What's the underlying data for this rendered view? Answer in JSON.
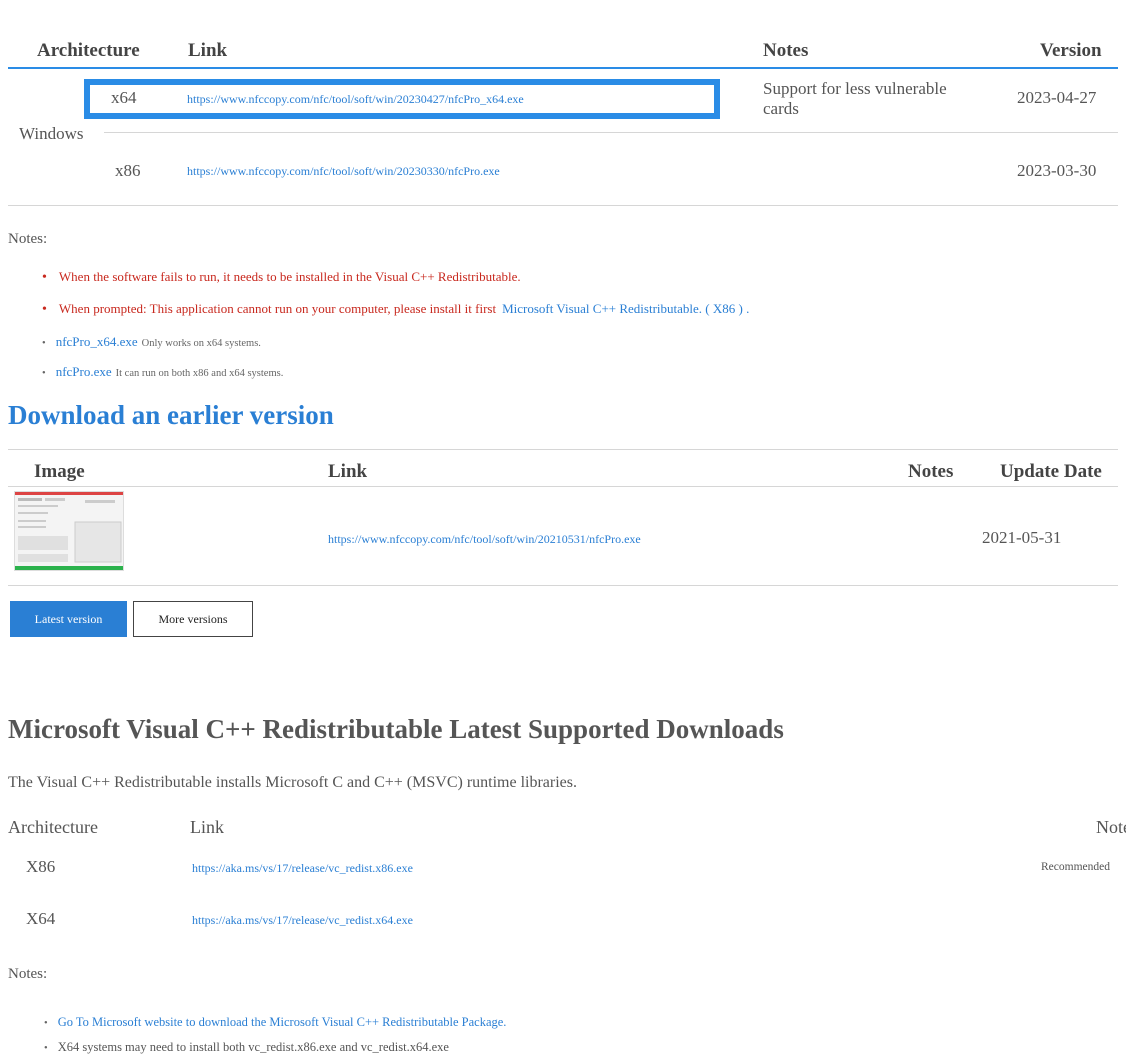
{
  "table1": {
    "headers": [
      "Architecture",
      "Link",
      "Notes",
      "Version"
    ],
    "os": "Windows",
    "rows": [
      {
        "arch": "x64",
        "link": "https://www.nfccopy.com/nfc/tool/soft/win/20230427/nfcPro_x64.exe",
        "note": "Support for less vulnerable cards",
        "version": "2023-04-27"
      },
      {
        "arch": "x86",
        "link": "https://www.nfccopy.com/nfc/tool/soft/win/20230330/nfcPro.exe",
        "note": "",
        "version": "2023-03-30"
      }
    ]
  },
  "notes1": {
    "label": "Notes:",
    "items": [
      {
        "text": "When the software fails to run, it needs to be installed in the Visual C++ Redistributable."
      },
      {
        "text": "When prompted: This application cannot run on your computer, please install it first",
        "link": "Microsoft Visual C++ Redistributable. ( X86 ) ."
      },
      {
        "link": "nfcPro_x64.exe",
        "text": "Only works on x64 systems."
      },
      {
        "link": "nfcPro.exe",
        "text": "It can run on both x86 and x64 systems."
      }
    ]
  },
  "earlier": {
    "title": "Download an earlier version",
    "headers": [
      "Image",
      "Link",
      "Notes",
      "Update Date"
    ],
    "row": {
      "link": "https://www.nfccopy.com/nfc/tool/soft/win/20210531/nfcPro.exe",
      "note": "",
      "date": "2021-05-31"
    },
    "buttons": {
      "latest": "Latest version",
      "more": "More versions"
    }
  },
  "msvc": {
    "title": "Microsoft Visual C++ Redistributable Latest Supported Downloads",
    "description": "The Visual C++ Redistributable installs Microsoft C and C++ (MSVC) runtime libraries.",
    "headers": [
      "Architecture",
      "Link",
      "Notes"
    ],
    "rows": [
      {
        "arch": "X86",
        "link": "https://aka.ms/vs/17/release/vc_redist.x86.exe",
        "note": "Recommended"
      },
      {
        "arch": "X64",
        "link": "https://aka.ms/vs/17/release/vc_redist.x64.exe",
        "note": ""
      }
    ]
  },
  "notes2": {
    "label": "Notes:",
    "items": [
      {
        "link": "Go To Microsoft website to download the Microsoft Visual C++ Redistributable Package."
      },
      {
        "text": "X64 systems may need to install both vc_redist.x86.exe and vc_redist.x64.exe"
      }
    ]
  },
  "colors": {
    "accent": "#2a7fd4",
    "highlight": "#2a8ce6",
    "warning": "#c8281e"
  }
}
